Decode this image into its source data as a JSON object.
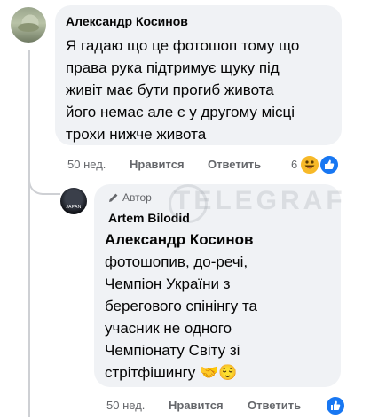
{
  "comment1": {
    "author": "Александр Косинов",
    "text_lines": [
      "Я гадаю що це фотошоп тому що",
      "права рука підтримує щуку під",
      "живіт має бути прогиб живота",
      "його немає але є у другому місці",
      "трохи нижче живота"
    ],
    "time": "50 нед.",
    "like_label": "Нравится",
    "reply_label": "Ответить",
    "reaction_count": "6",
    "reactions": [
      "haha-emoji",
      "like-thumb"
    ]
  },
  "reply": {
    "badge": "Автор",
    "author": "Artem Bilodid",
    "mention": "Александр Косинов",
    "text_lines": [
      "фотошопив, до-речі,",
      "Чемпіон України з",
      "берегового спінінгу та",
      "учасник не одного",
      "Чемпіонату Світу зі",
      "стрітфішингу 🤝😌"
    ],
    "avatar_text": "JAPAN",
    "time": "50 нед.",
    "like_label": "Нравится",
    "reply_label": "Ответить",
    "reactions": [
      "like-thumb"
    ]
  },
  "watermark": "TELEGRAF",
  "colors": {
    "bubble": "#f0f2f5",
    "meta": "#65676b",
    "like_blue": "#1877f2",
    "haha_yellow": "#f7b928",
    "thread_line": "#ced0d4"
  }
}
